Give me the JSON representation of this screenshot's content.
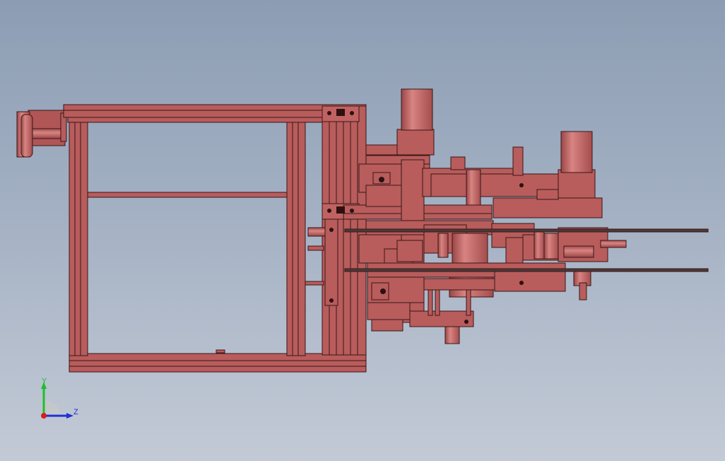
{
  "viewport": {
    "background_top": "#8c9db3",
    "background_bottom": "#c3cad6"
  },
  "model": {
    "part_color": "#b85c5c",
    "part_color_light": "#d27a78",
    "edge_color": "#3a1616",
    "rod_color": "#5a4a4a"
  },
  "triad": {
    "y_label": "Y",
    "z_label": "Z",
    "y_color": "#1fbf2a",
    "z_color": "#2030d8",
    "x_color": "#d81e1e"
  }
}
